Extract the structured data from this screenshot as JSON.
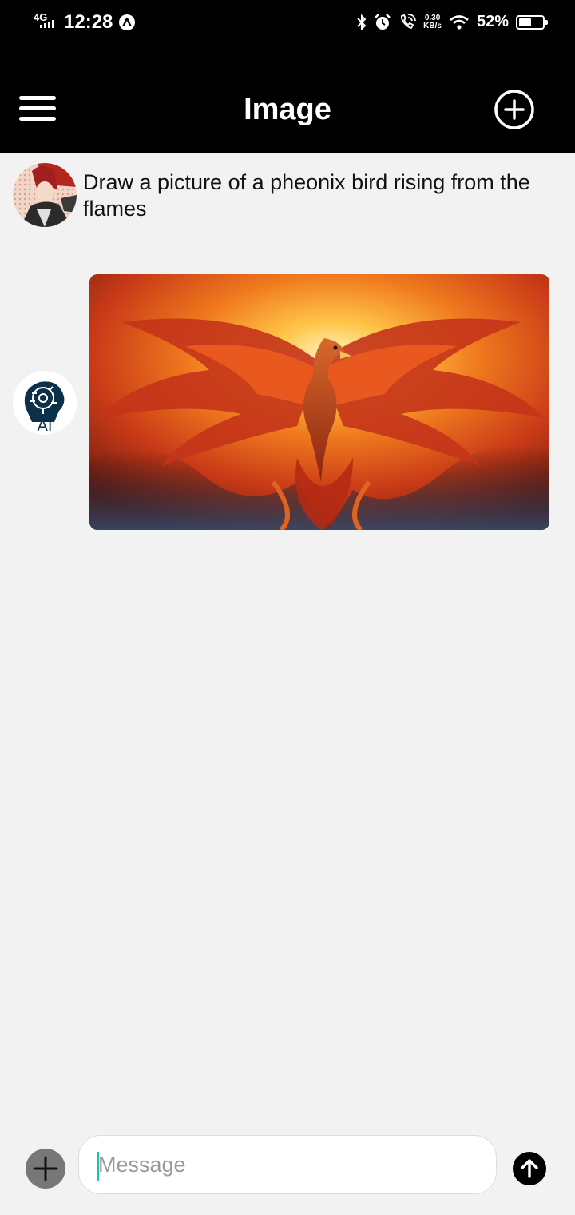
{
  "status_bar": {
    "network": "4G",
    "time": "12:28",
    "speed_value": "0.30",
    "speed_unit": "KB/s",
    "battery_percent": "52%",
    "battery_level": 0.52,
    "icons": [
      "signal-icon",
      "app-notification-icon",
      "bluetooth-icon",
      "alarm-icon",
      "wifi-calling-icon",
      "wifi-icon",
      "battery-icon"
    ]
  },
  "header": {
    "title": "Image",
    "menu_icon": "hamburger-menu-icon",
    "new_chat_icon": "plus-circle-icon"
  },
  "chat": {
    "user_message": "Draw a picture of a pheonix bird rising from the flames",
    "ai_avatar_text": "AI",
    "image_subject": "phoenix-image"
  },
  "composer": {
    "placeholder": "Message",
    "value": "",
    "attach_icon": "plus-icon",
    "send_icon": "arrow-up-icon"
  },
  "colors": {
    "header_bg": "#000000",
    "page_bg": "#f2f2f2",
    "caret": "#19c2b0",
    "attach_button": "#777777"
  }
}
